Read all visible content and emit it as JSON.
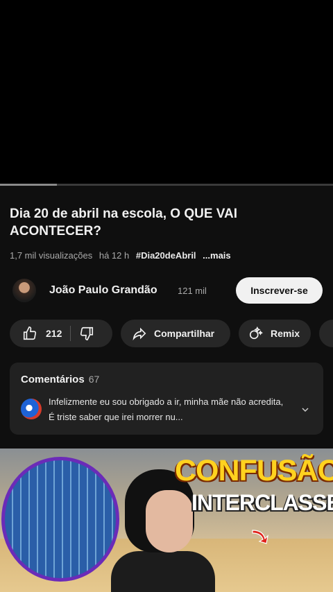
{
  "video": {
    "progress_fraction": 0.17
  },
  "title": "Dia 20 de abril na escola, O QUE VAI ACONTECER?",
  "meta": {
    "views": "1,7 mil visualizações",
    "age": "há 12 h",
    "hashtag": "#Dia20deAbril",
    "more": "...mais"
  },
  "channel": {
    "name": "João Paulo Grandão",
    "subscribers": "121 mil",
    "subscribe_label": "Inscrever-se"
  },
  "actions": {
    "like_count": "212",
    "share_label": "Compartilhar",
    "remix_label": "Remix"
  },
  "comments": {
    "heading": "Comentários",
    "count": "67",
    "top_comment": "Infelizmente eu sou obrigado a ir, minha mãe não acredita, É triste saber que irei morrer nu..."
  },
  "ad": {
    "headline_1": "CONFUSÃO",
    "headline_2": "INTERCLASSE"
  },
  "colors": {
    "background": "#0f0f0f",
    "pill": "#272727",
    "comment_panel": "#212121",
    "subscribe_bg": "#f1f1f1"
  }
}
